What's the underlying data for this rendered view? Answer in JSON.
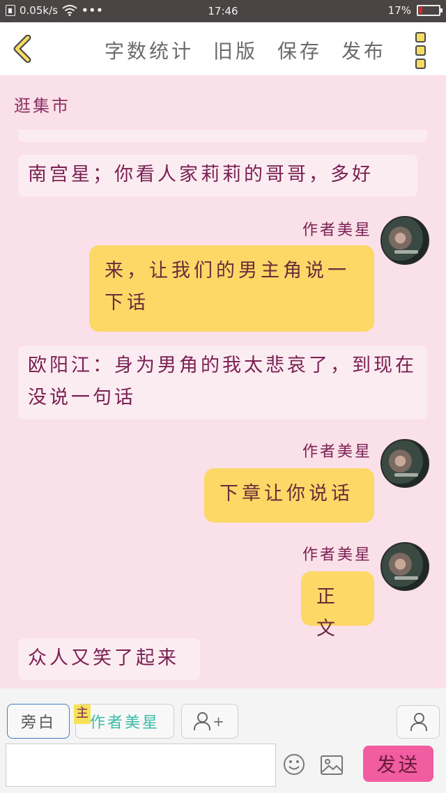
{
  "status_bar": {
    "network_speed": "0.05k/s",
    "time": "17:46",
    "battery": "17%",
    "battery_level": 0.17
  },
  "header": {
    "actions": [
      "字数统计",
      "旧版",
      "保存",
      "发布"
    ]
  },
  "chat": {
    "section_title": "逛集市",
    "messages": [
      {
        "type": "narration",
        "text": "南宫星；你看人家莉莉的哥哥，多好"
      },
      {
        "type": "author",
        "name": "作者美星",
        "text": "来，让我们的男主角说一下话"
      },
      {
        "type": "narration",
        "text": "欧阳江：身为男角的我太悲哀了，到现在没说一句话"
      },
      {
        "type": "author",
        "name": "作者美星",
        "text": "下章让你说话"
      },
      {
        "type": "author",
        "name": "作者美星",
        "text": "正文"
      },
      {
        "type": "narration",
        "text": "众人又笑了起来"
      }
    ]
  },
  "composer": {
    "narrator_label": "旁白",
    "main_tag": "主",
    "author_label": "作者美星",
    "add_role_label": "+",
    "send_label": "发送",
    "input_value": ""
  },
  "colors": {
    "background": "#fae0e8",
    "author_bubble": "#fcd867",
    "narration_bubble": "#fbecf1",
    "send_button": "#f25ca0",
    "text_accent": "#7a1f52"
  }
}
